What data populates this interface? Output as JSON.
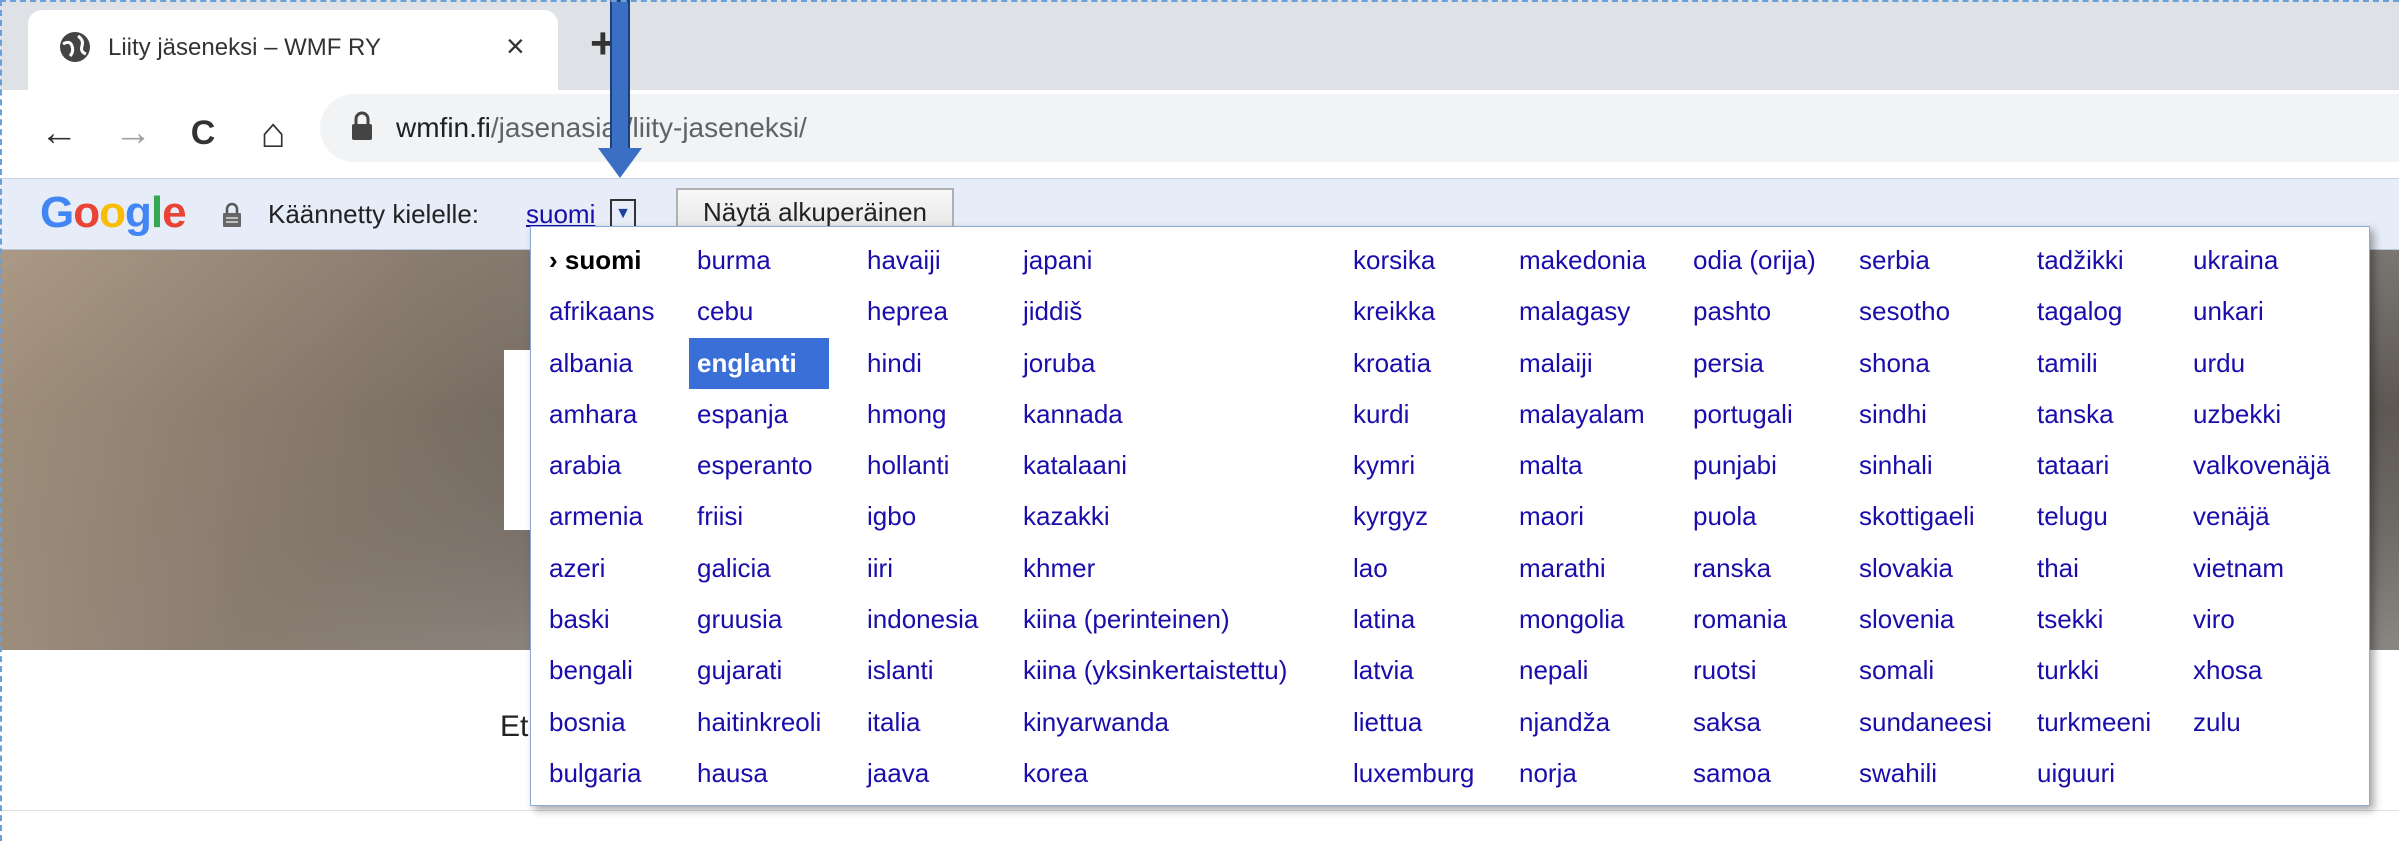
{
  "tab": {
    "title": "Liity jäseneksi – WMF RY",
    "close": "×",
    "new_tab": "+"
  },
  "toolbar": {
    "back": "←",
    "forward": "→",
    "reload": "C",
    "home": "⌂",
    "url_host": "wmfin.fi",
    "url_path": "/jasenasiat/liity-jaseneksi/"
  },
  "translate_bar": {
    "logo": [
      "G",
      "o",
      "o",
      "g",
      "l",
      "e"
    ],
    "label": "Käännetty kielelle:",
    "language": "suomi",
    "dropdown_glyph": "▼",
    "original_button": "Näytä alkuperäinen"
  },
  "page": {
    "text_fragment": "Et"
  },
  "menu": {
    "columns": [
      [
        "› suomi",
        "afrikaans",
        "albania",
        "amhara",
        "arabia",
        "armenia",
        "azeri",
        "baski",
        "bengali",
        "bosnia",
        "bulgaria"
      ],
      [
        "burma",
        "cebu",
        "englanti",
        "espanja",
        "esperanto",
        "friisi",
        "galicia",
        "gruusia",
        "gujarati",
        "haitinkreoli",
        "hausa"
      ],
      [
        "havaiji",
        "heprea",
        "hindi",
        "hmong",
        "hollanti",
        "igbo",
        "iiri",
        "indonesia",
        "islanti",
        "italia",
        "jaava"
      ],
      [
        "japani",
        "jiddiš",
        "joruba",
        "kannada",
        "katalaani",
        "kazakki",
        "khmer",
        "kiina (perinteinen)",
        "kiina (yksinkertaistettu)",
        "kinyarwanda",
        "korea"
      ],
      [
        "korsika",
        "kreikka",
        "kroatia",
        "kurdi",
        "kymri",
        "kyrgyz",
        "lao",
        "latina",
        "latvia",
        "liettua",
        "luxemburg"
      ],
      [
        "makedonia",
        "malagasy",
        "malaiji",
        "malayalam",
        "malta",
        "maori",
        "marathi",
        "mongolia",
        "nepali",
        "njandža",
        "norja"
      ],
      [
        "odia (orija)",
        "pashto",
        "persia",
        "portugali",
        "punjabi",
        "puola",
        "ranska",
        "romania",
        "ruotsi",
        "saksa",
        "samoa"
      ],
      [
        "serbia",
        "sesotho",
        "shona",
        "sindhi",
        "sinhali",
        "skottigaeli",
        "slovakia",
        "slovenia",
        "somali",
        "sundaneesi",
        "swahili"
      ],
      [
        "tadžikki",
        "tagalog",
        "tamili",
        "tanska",
        "tataari",
        "telugu",
        "thai",
        "tsekki",
        "turkki",
        "turkmeeni",
        "uiguuri"
      ],
      [
        "ukraina",
        "unkari",
        "urdu",
        "uzbekki",
        "valkovenäjä",
        "venäjä",
        "vietnam",
        "viro",
        "xhosa",
        "zulu"
      ]
    ],
    "current": "› suomi",
    "highlighted": "englanti"
  }
}
